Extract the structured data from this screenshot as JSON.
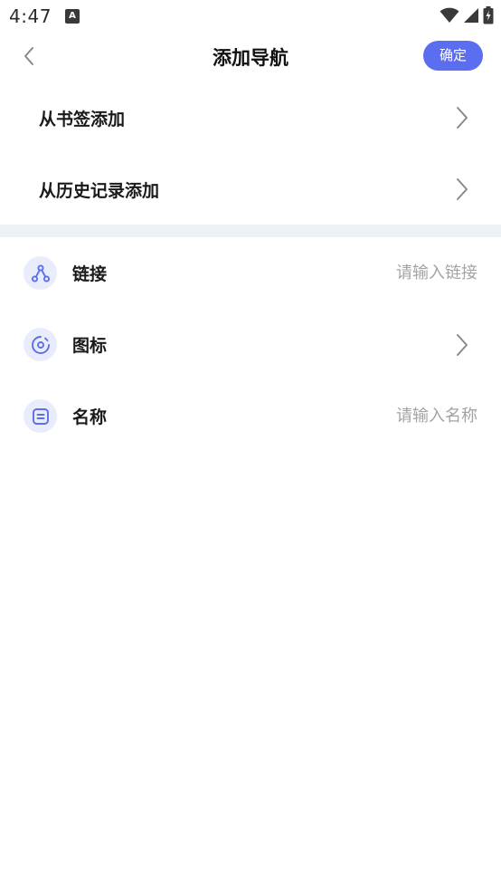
{
  "status_bar": {
    "time": "4:47",
    "notification_glyph": "A"
  },
  "header": {
    "title": "添加导航",
    "confirm_label": "确定"
  },
  "add_options": [
    {
      "label": "从书签添加"
    },
    {
      "label": "从历史记录添加"
    }
  ],
  "form": {
    "link": {
      "label": "链接",
      "value": "",
      "placeholder": "请输入链接",
      "icon": "share-icon"
    },
    "icon": {
      "label": "图标",
      "icon": "disc-icon"
    },
    "name": {
      "label": "名称",
      "value": "",
      "placeholder": "请输入名称",
      "icon": "text-box-icon"
    }
  },
  "colors": {
    "accent": "#5b6ef0",
    "icon_bg": "#e9ecfb",
    "divider": "#edf1f5",
    "placeholder": "#a3a3a3"
  }
}
